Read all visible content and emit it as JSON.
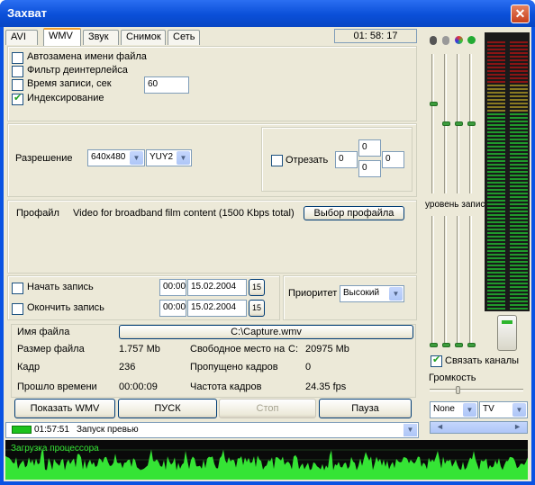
{
  "window": {
    "title": "Захват",
    "close": "✕"
  },
  "tabs": [
    "AVI",
    "WMV",
    "Звук",
    "Снимок",
    "Сеть"
  ],
  "active_tab": "WMV",
  "clock": "01: 58: 17",
  "options": {
    "auto_rename": "Автозамена имени файла",
    "deinterlace": "Фильтр деинтерлейса",
    "record_time": "Время записи, сек",
    "record_time_value": "60",
    "indexing": "Индексирование"
  },
  "resolution": {
    "label": "Разрешение",
    "size": "640x480",
    "format": "YUY2"
  },
  "crop": {
    "label": "Отрезать",
    "left": "0",
    "top": "0",
    "right": "0",
    "bottom": "0"
  },
  "profile": {
    "label": "Профайл",
    "value": "Video for broadband film content (1500 Kbps total)",
    "button": "Выбор профайла"
  },
  "schedule": {
    "start_label": "Начать запись",
    "start_time": "00:00",
    "start_date": "15.02.2004",
    "stop_label": "Окончить запись",
    "stop_time": "00:00",
    "stop_date": "15.02.2004",
    "calendar": "15",
    "priority_label": "Приоритет",
    "priority_value": "Высокий"
  },
  "info": {
    "filename_label": "Имя файла",
    "filename": "C:\\Capture.wmv",
    "filesize_label": "Размер файла",
    "filesize": "1.757 Mb",
    "free_label": "Свободное место на",
    "drive": "C:",
    "free": "20975 Mb",
    "frame_label": "Кадр",
    "frame": "236",
    "dropped_label": "Пропущено кадров",
    "dropped": "0",
    "elapsed_label": "Прошло времени",
    "elapsed": "00:00:09",
    "fps_label": "Частота кадров",
    "fps": "24.35 fps"
  },
  "controls": {
    "show_wmv": "Показать WMV",
    "start": "ПУСК",
    "stop": "Стоп",
    "pause": "Пауза"
  },
  "status": {
    "time": "01:57:51",
    "message": "Запуск превью"
  },
  "wave_label": "Загрузка процессора",
  "right": {
    "levels_label": "уровень записи",
    "link_channels": "Связать каналы",
    "volume": "Громкость",
    "source1": "None",
    "source2": "TV"
  },
  "colors": {
    "accent": "#0a53e3",
    "meter_green": "#1f9a2b",
    "wave": "#35e435"
  }
}
